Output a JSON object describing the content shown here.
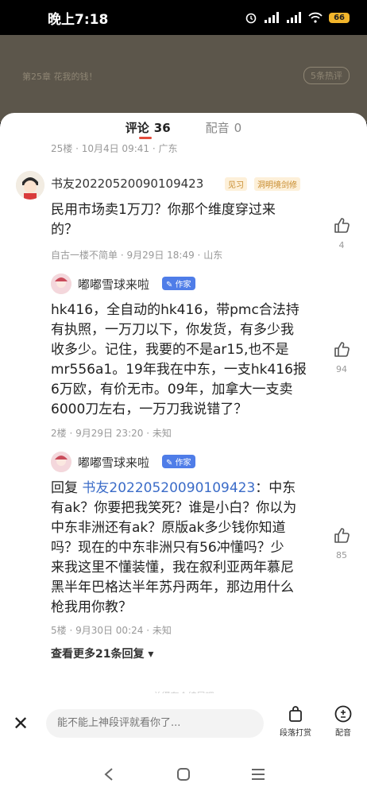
{
  "status_bar": {
    "time": "晚上7:18",
    "battery": "66"
  },
  "reader": {
    "chapter": "第25章 花我的钱！",
    "hot_label": "5条热评"
  },
  "tabs": [
    {
      "label": "评论",
      "count": "36"
    },
    {
      "label": "配音",
      "count": "0"
    }
  ],
  "top_meta": "25楼 · 10月4日 09:41 · 广东",
  "comments": [
    {
      "user": "书友20220520090109423",
      "level": "见习",
      "title": "洞明境剑修",
      "text_lines": [
        "民用市场卖1万刀？你那个维度穿过来",
        "的？"
      ],
      "meta": "自古一楼不简单 · 9月29日 18:49 · 山东",
      "likes": "4"
    },
    {
      "user": "嘟嘟雪球来啦",
      "author_badge": "作家",
      "text_lines": [
        "hk416，全自动的hk416，带pmc合法持",
        "有执照，一万刀以下，你发货，有多少我",
        "收多少。记住，我要的不是ar15,也不是",
        "mr556a1。19年我在中东，一支hk416报",
        "6万欧，有价无市。09年，加拿大一支卖",
        "6000刀左右，一万刀我说错了？"
      ],
      "meta": "2楼 · 9月29日 23:20 · 未知",
      "likes": "94"
    },
    {
      "user": "嘟嘟雪球来啦",
      "author_badge": "作家",
      "reply_prefix": "回复 ",
      "reply_target": "书友20220520090109423",
      "reply_colon": "：中东",
      "text_lines": [
        "有ak？你要把我笑死？谁是小白？你以为",
        "中东非洲还有ak？原版ak多少钱你知道",
        "吗？现在的中东非洲只有56冲懂吗？少",
        "来我这里不懂装懂，我在叙利亚两年慕尼",
        "黑半年巴格达半年苏丹两年，那边用什么",
        "枪我用你教？"
      ],
      "meta": "5楼 · 9月30日 00:24 · 未知",
      "likes": "85"
    }
  ],
  "more_replies": "查看更多21条回复",
  "fade_text": "总得有个结尾吧",
  "input": {
    "placeholder": "能不能上神段评就看你了..."
  },
  "actions": [
    {
      "label": "段落打赏",
      "icon": "gift-bag-icon"
    },
    {
      "label": "配音",
      "icon": "dubbing-icon"
    }
  ],
  "colors": {
    "accent": "#e34b3b",
    "author_badge": "#4f7de8",
    "link": "#3b6cc8"
  }
}
